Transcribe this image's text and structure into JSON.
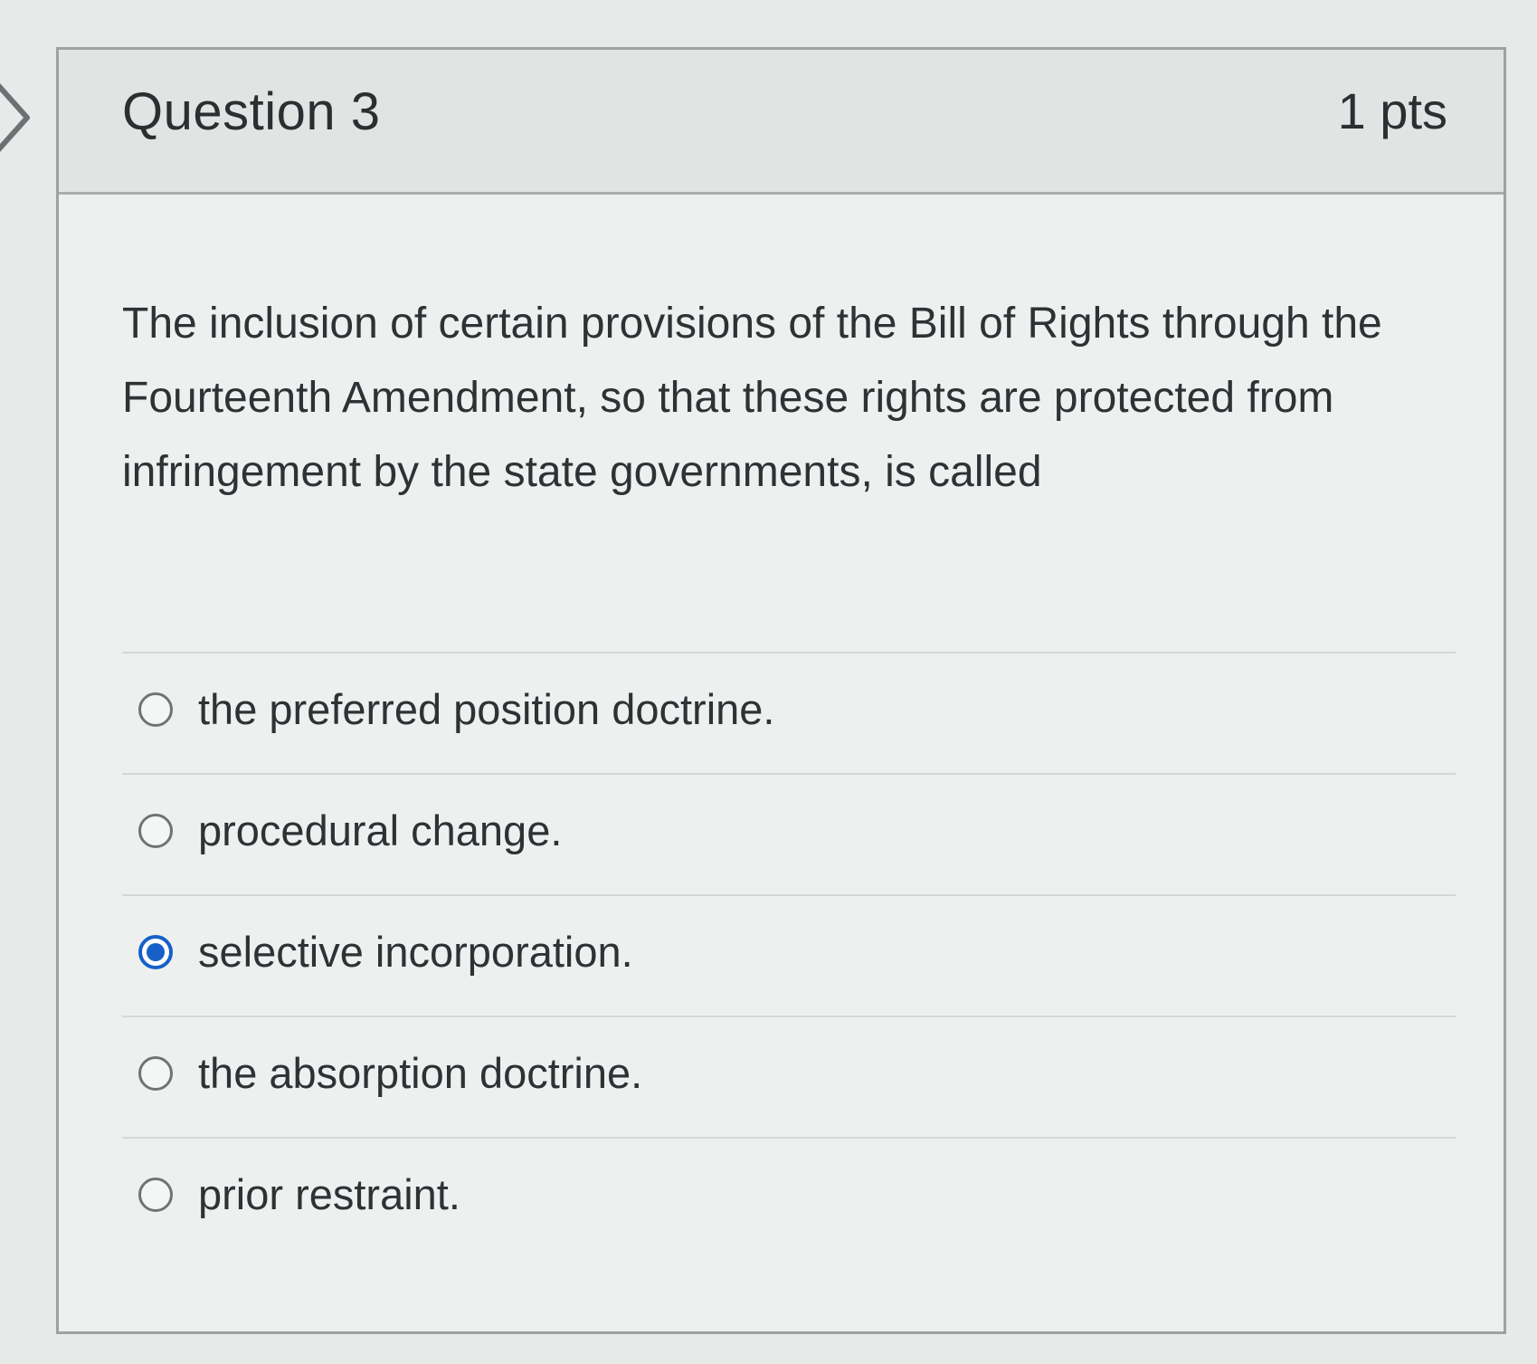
{
  "question": {
    "title": "Question 3",
    "points": "1 pts",
    "text": "The inclusion of certain provisions of the Bill of Rights through the Fourteenth Amendment, so that these rights are protected from infringement by the state governments, is called"
  },
  "answers": [
    {
      "label": "the preferred position doctrine.",
      "selected": false
    },
    {
      "label": "procedural change.",
      "selected": false
    },
    {
      "label": "selective incorporation.",
      "selected": true
    },
    {
      "label": "the absorption doctrine.",
      "selected": false
    },
    {
      "label": "prior restraint.",
      "selected": false
    }
  ],
  "colors": {
    "selected_radio": "#1660c8",
    "text": "#2f3235"
  },
  "icons": {
    "left_nav": "chevron-right-icon"
  }
}
